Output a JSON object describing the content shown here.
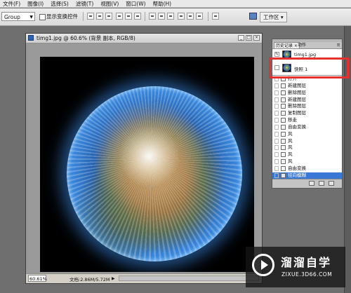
{
  "menubar": {
    "items": [
      "文件(F)",
      "图像(I)",
      "选择(S)",
      "滤镜(T)",
      "视图(V)",
      "窗口(W)",
      "帮助(H)"
    ]
  },
  "options_bar": {
    "auto_select_value": "Group",
    "show_transform_controls_label": "显示变换控件",
    "workspace_label": "工作区 ▾"
  },
  "document": {
    "title": "timg1.jpg @ 60.6% (背景 副本, RGB/8)",
    "zoom": "60.61%",
    "doc_size": "文档:2.86M/5.72M"
  },
  "history_panel": {
    "tabs": [
      "历史记录 ×",
      "动作"
    ],
    "menu_glyph": "≡",
    "snapshots": [
      "timg1.jpg",
      "快照 1"
    ],
    "steps": [
      "打开",
      "新建图层",
      "删除图层",
      "新建图层",
      "删除图层",
      "复制图层",
      "移走",
      "自由变换",
      "风",
      "风",
      "风",
      "风",
      "风",
      "自由变换",
      "径向模糊"
    ],
    "selected_index": 14
  },
  "colors": {
    "highlight_border": "#e53030",
    "selection": "#3a78d6"
  },
  "watermark": {
    "title": "溜溜自学",
    "url": "ZIXUE.3D66.COM"
  }
}
